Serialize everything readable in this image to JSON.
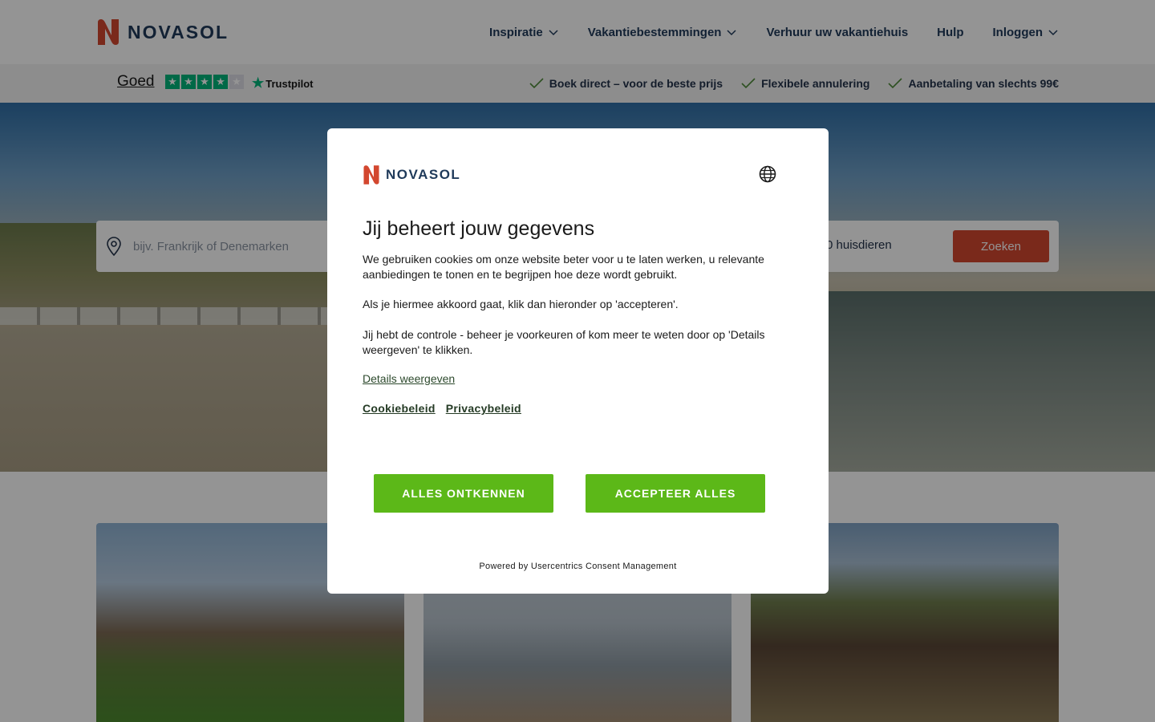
{
  "brand": {
    "name": "NOVASOL",
    "color": "#d3472f"
  },
  "nav": {
    "items": [
      {
        "label": "Inspiratie",
        "has_dropdown": true
      },
      {
        "label": "Vakantiebestemmingen",
        "has_dropdown": true
      },
      {
        "label": "Verhuur uw vakantiehuis",
        "has_dropdown": false
      },
      {
        "label": "Hulp",
        "has_dropdown": false
      },
      {
        "label": "Inloggen",
        "has_dropdown": true
      }
    ]
  },
  "trustpilot": {
    "rating_text": "Goed",
    "stars": 4,
    "max_stars": 5,
    "logo_text": "Trustpilot",
    "color": "#00b67a"
  },
  "usps": [
    {
      "label": "Boek direct – voor de beste prijs"
    },
    {
      "label": "Flexibele annulering"
    },
    {
      "label": "Aanbetaling van slechts 99€"
    }
  ],
  "search": {
    "destination_placeholder": "bijv. Frankrijk of Denemarken",
    "pets_text": "0 huisdieren",
    "button_label": "Zoeken"
  },
  "consent": {
    "logo_text": "NOVASOL",
    "language_icon": "globe-icon",
    "title": "Jij beheert jouw gegevens",
    "paragraphs": [
      "We gebruiken cookies om onze website beter voor u te laten werken, u relevante aanbiedingen te tonen en te begrijpen hoe deze wordt gebruikt.",
      "Als je hiermee akkoord gaat, klik dan hieronder op 'accepteren'.",
      "Jij hebt de controle - beheer je voorkeuren of kom meer te weten door op 'Details weergeven' te klikken."
    ],
    "details_link": "Details weergeven",
    "cookie_policy_link": "Cookiebeleid",
    "privacy_policy_link": "Privacybeleid",
    "deny_button": "ALLES ONTKENNEN",
    "accept_button": "ACCEPTEER ALLES",
    "button_color": "#5cb818",
    "powered_by": "Powered by Usercentrics Consent Management"
  }
}
